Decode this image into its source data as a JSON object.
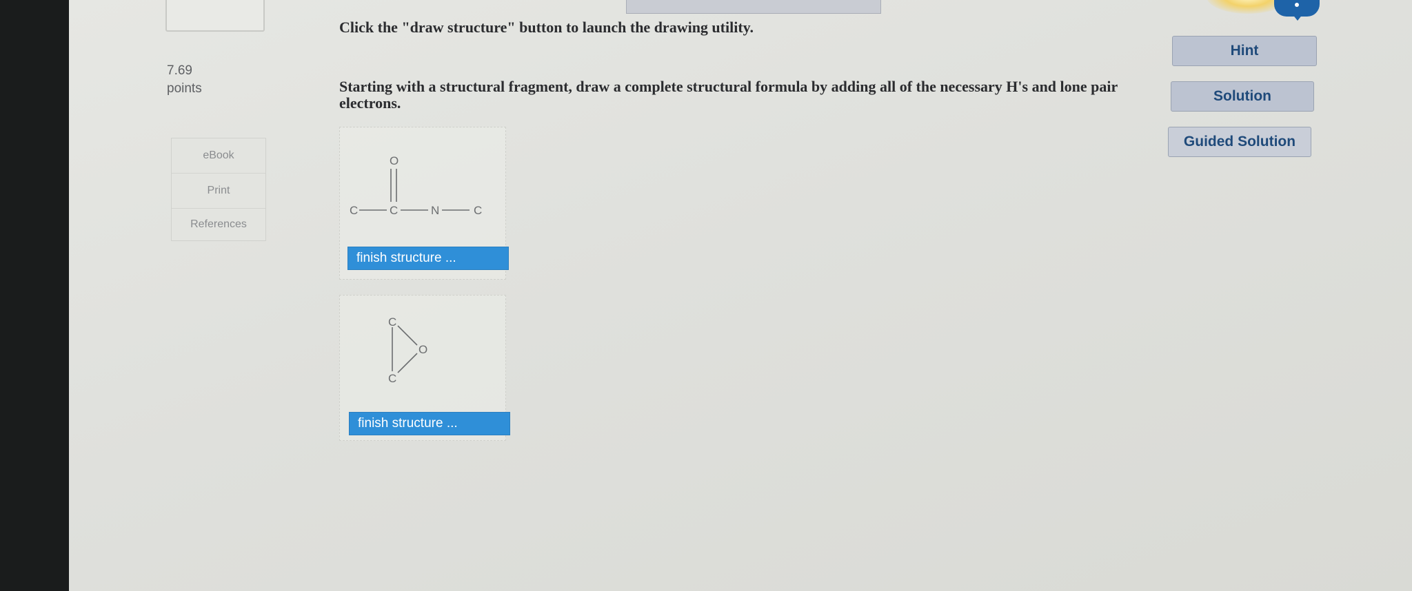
{
  "question": {
    "points_value": "7.69",
    "points_label": "points",
    "instruction_1": "Click the \"draw structure\" button to launch the drawing utility.",
    "instruction_2": "Starting with a structural fragment, draw a complete structural formula by adding all of the necessary H's and lone pair electrons."
  },
  "sidebar": {
    "items": [
      {
        "label": "eBook"
      },
      {
        "label": "Print"
      },
      {
        "label": "References"
      }
    ]
  },
  "structures": [
    {
      "atoms": {
        "c1": "C",
        "c2": "C",
        "n": "N",
        "c3": "C",
        "o": "O"
      },
      "button_label": "finish structure ..."
    },
    {
      "atoms": {
        "c_top": "C",
        "c_bottom": "C",
        "o": "O"
      },
      "button_label": "finish structure ..."
    }
  ],
  "help_buttons": {
    "hint": "Hint",
    "solution": "Solution",
    "guided_solution": "Guided Solution"
  },
  "colors": {
    "finish_button": "#2f8fd8",
    "help_button": "#bcc3d1",
    "help_text": "#1f4a7a",
    "chat_icon": "#1e63a8"
  }
}
